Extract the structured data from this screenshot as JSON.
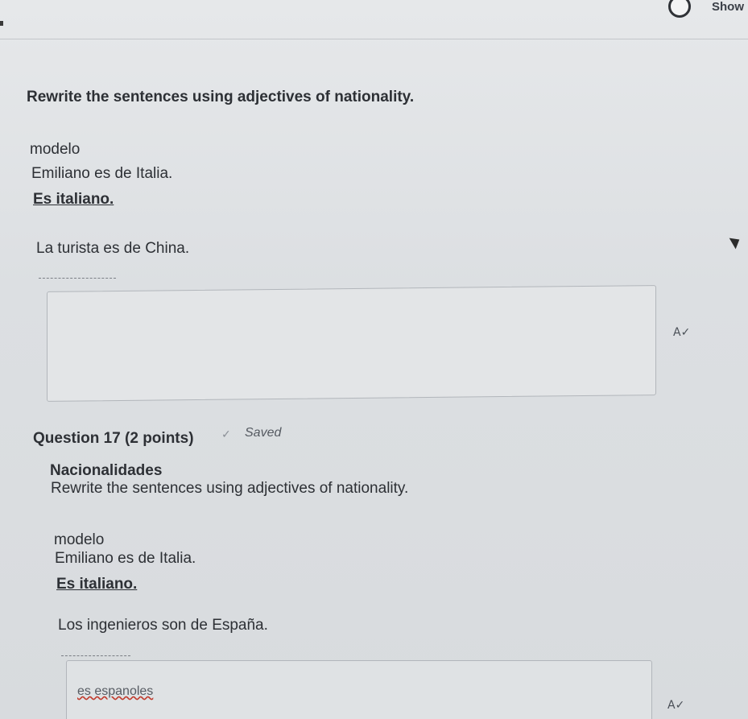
{
  "header": {
    "show_link": "Show"
  },
  "q16": {
    "instructions": "Rewrite the sentences using adjectives of nationality.",
    "modelo_label": "modelo",
    "example_sentence": "Emiliano es de Italia.",
    "example_answer": "Es italiano.",
    "prompt": "La turista es de China.",
    "answer_value": "",
    "spellcheck_icon": "A✓"
  },
  "q17": {
    "title": "Question 17 (2 points)",
    "saved_icon": "✓",
    "saved_label": "Saved",
    "section_title": "Nacionalidades",
    "instructions": "Rewrite the sentences using adjectives of nationality.",
    "modelo_label": "modelo",
    "example_sentence": "Emiliano es de Italia.",
    "example_answer": "Es italiano.",
    "prompt": "Los ingenieros son de España.",
    "answer_value": "es espanoles",
    "spellcheck_icon": "A✓"
  }
}
